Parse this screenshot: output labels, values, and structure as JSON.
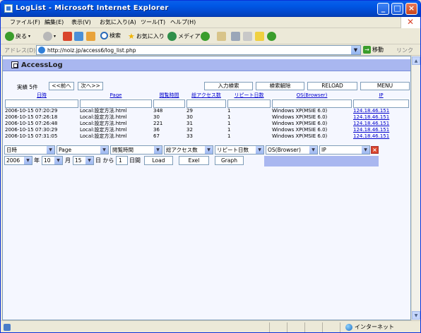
{
  "window": {
    "title": "LogList - Microsoft Internet Explorer"
  },
  "menu": [
    "ファイル(F)",
    "編集(E)",
    "表示(V)",
    "お気に入り(A)",
    "ツール(T)",
    "ヘルプ(H)"
  ],
  "toolbar": {
    "back": "戻る",
    "search": "検索",
    "favorites": "お気に入り",
    "media": "メディア"
  },
  "address": {
    "label": "アドレス(D)",
    "url": "http://noiz.jp/access6/log_list.php",
    "go": "移動",
    "links": "リンク"
  },
  "status": {
    "zone": "インターネット"
  },
  "page": {
    "title": "AccessLog",
    "count_label": "実績  5件",
    "prev": "<<前へ",
    "next": "次へ>>",
    "buttons": {
      "search": "入力検索",
      "clear": "検索解除",
      "reload": "RELOAD",
      "menu": "MENU"
    }
  },
  "table": {
    "headers": [
      "日時",
      "Page",
      "閲覧時間",
      "総アクセス数",
      "リピート日数",
      "OS(Browser)",
      "IP"
    ],
    "rows": [
      [
        "2006-10-15 07:20:29",
        "Local:設定方法.html",
        "348",
        "29",
        "1",
        "Windows XP(MSIE 6.0)",
        "124.18.46.151"
      ],
      [
        "2006-10-15 07:26:18",
        "Local:設定方法.html",
        "30",
        "30",
        "1",
        "Windows XP(MSIE 6.0)",
        "124.18.46.151"
      ],
      [
        "2006-10-15 07:26:48",
        "Local:設定方法.html",
        "221",
        "31",
        "1",
        "Windows XP(MSIE 6.0)",
        "124.18.46.151"
      ],
      [
        "2006-10-15 07:30:29",
        "Local:設定方法.html",
        "36",
        "32",
        "1",
        "Windows XP(MSIE 6.0)",
        "124.18.46.151"
      ],
      [
        "2006-10-15 07:31:05",
        "Local:設定方法.html",
        "67",
        "33",
        "1",
        "Windows XP(MSIE 6.0)",
        "124.18.46.151"
      ]
    ]
  },
  "filters": [
    "日時",
    "Page",
    "閲覧時間",
    "総アクセス数",
    "リピート日数",
    "OS(Browser)",
    "IP"
  ],
  "date": {
    "year": "2006",
    "year_label": "年",
    "month": "10",
    "month_label": "月",
    "day": "15",
    "day_label": "日 から",
    "days": "1",
    "days_label": "日間",
    "load": "Load",
    "excel": "Exel",
    "graph": "Graph"
  }
}
